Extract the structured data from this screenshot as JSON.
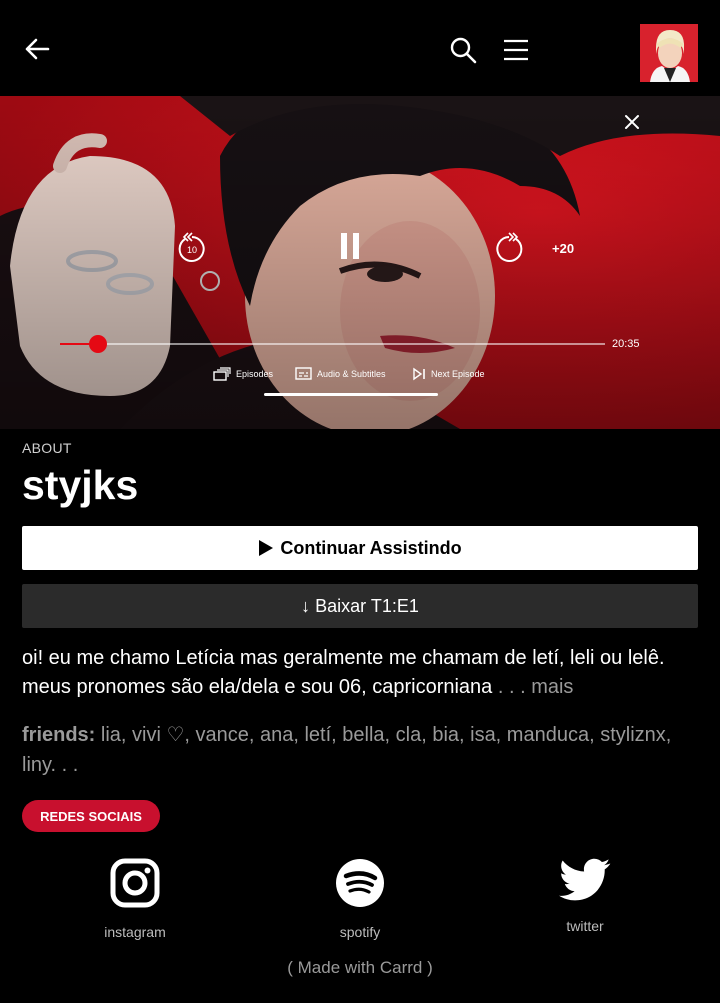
{
  "header": {
    "back_icon": "arrow-left-icon",
    "search_icon": "search-icon",
    "menu_icon": "hamburger-menu-icon",
    "avatar": "profile-avatar"
  },
  "player": {
    "time_remaining": "20:35",
    "skip_forward_label": "+20",
    "progress": 0.07,
    "episodes_label": "Episodes",
    "audio_label": "Audio & Subtitles",
    "next_label": "Next Episode"
  },
  "about": {
    "section_label": "ABOUT",
    "name": "styjks",
    "play_label": "Continuar Assistindo",
    "download_label": "↓ Baixar T1:E1",
    "bio": "oi! eu me chamo Letícia mas geralmente me chamam de letí, leli ou lelê. meus pronomes são ela/dela e sou 06, capricorniana",
    "bio_more": " . . . mais",
    "friends_label": "friends:",
    "friends_list": " lia, vivi ♡, vance, ana, letí, bella, cla, bia, isa, manduca, styliznx, liny. . ."
  },
  "social": {
    "section_button": "REDES SOCIAIS",
    "links": [
      {
        "label": "instagram",
        "icon": "instagram-icon"
      },
      {
        "label": "spotify",
        "icon": "spotify-icon"
      },
      {
        "label": "twitter",
        "icon": "twitter-icon"
      }
    ]
  },
  "footer": {
    "credit": "( Made with Carrd )"
  },
  "colors": {
    "accent_red": "#e50914",
    "pill_red": "#c8102e",
    "background": "#000000"
  }
}
